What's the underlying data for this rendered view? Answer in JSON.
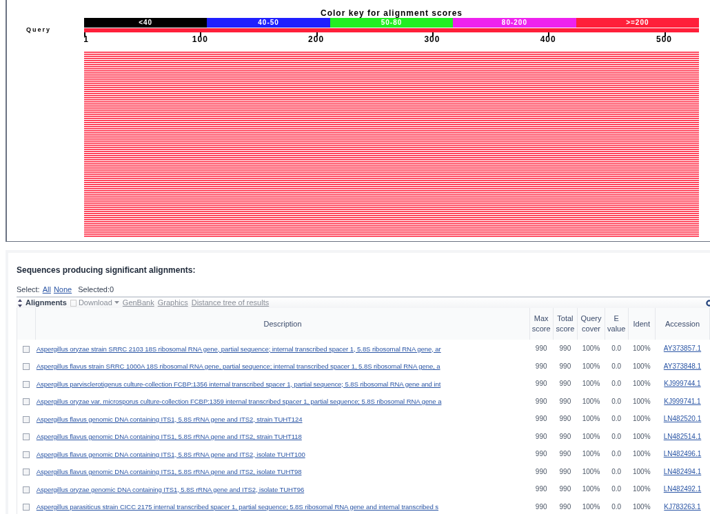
{
  "graphic": {
    "title": "Color key for alignment scores",
    "query_label": "Query",
    "color_key": [
      {
        "label": "<40",
        "color": "#000000"
      },
      {
        "label": "40-50",
        "color": "#1f1fff"
      },
      {
        "label": "50-80",
        "color": "#22ee22"
      },
      {
        "label": "80-200",
        "color": "#ee22ee"
      },
      {
        "label": ">=200",
        "color": "#ff1f3a"
      }
    ],
    "ticks": [
      "1",
      "100",
      "200",
      "300",
      "400",
      "500"
    ]
  },
  "results": {
    "heading": "Sequences producing significant alignments:",
    "select_label": "Select:",
    "select_links": [
      "All",
      "None"
    ],
    "selected_count": "Selected:0",
    "toolbar": {
      "title": "Alignments",
      "actions": [
        {
          "label": "Download",
          "kind": "menu",
          "disabled": true
        },
        {
          "label": "GenBank",
          "kind": "link",
          "disabled": true
        },
        {
          "label": "Graphics",
          "kind": "link",
          "disabled": true
        },
        {
          "label": "Distance tree of results",
          "kind": "link",
          "disabled": true
        }
      ]
    },
    "columns": [
      [
        "Description"
      ],
      [
        "Max",
        "score"
      ],
      [
        "Total",
        "score"
      ],
      [
        "Query",
        "cover"
      ],
      [
        "E",
        "value"
      ],
      [
        "Ident"
      ],
      [
        "Accession"
      ]
    ],
    "rows": [
      {
        "checked": false,
        "description": "Aspergillus oryzae strain SRRC 2103 18S ribosomal RNA gene, partial sequence; internal transcribed spacer 1, 5.8S ribosomal RNA gene, ar",
        "max_score": "990",
        "total_score": "990",
        "query_cover": "100%",
        "e_value": "0.0",
        "ident": "100%",
        "accession": "AY373857.1"
      },
      {
        "checked": false,
        "description": "Aspergillus flavus strain SRRC 1000A 18S ribosomal RNA gene, partial sequence; internal transcribed spacer 1, 5.8S ribosomal RNA gene, a",
        "max_score": "990",
        "total_score": "990",
        "query_cover": "100%",
        "e_value": "0.0",
        "ident": "100%",
        "accession": "AY373848.1"
      },
      {
        "checked": false,
        "description": "Aspergillus parvisclerotigenus culture-collection FCBP:1356 internal transcribed spacer 1, partial sequence; 5.8S ribosomal RNA gene and int",
        "max_score": "990",
        "total_score": "990",
        "query_cover": "100%",
        "e_value": "0.0",
        "ident": "100%",
        "accession": "KJ999744.1"
      },
      {
        "checked": false,
        "description": "Aspergillus oryzae var. microsporus culture-collection FCBP:1359 internal transcribed spacer 1, partial sequence; 5.8S ribosomal RNA gene a",
        "max_score": "990",
        "total_score": "990",
        "query_cover": "100%",
        "e_value": "0.0",
        "ident": "100%",
        "accession": "KJ999741.1"
      },
      {
        "checked": false,
        "description": "Aspergillus flavus genomic DNA containing ITS1, 5.8S rRNA gene and ITS2, strain TUHT124",
        "max_score": "990",
        "total_score": "990",
        "query_cover": "100%",
        "e_value": "0.0",
        "ident": "100%",
        "accession": "LN482520.1"
      },
      {
        "checked": false,
        "description": "Aspergillus flavus genomic DNA containing ITS1, 5.8S rRNA gene and ITS2, strain TUHT118",
        "max_score": "990",
        "total_score": "990",
        "query_cover": "100%",
        "e_value": "0.0",
        "ident": "100%",
        "accession": "LN482514.1"
      },
      {
        "checked": false,
        "description": "Aspergillus flavus genomic DNA containing ITS1, 5.8S rRNA gene and ITS2, isolate TUHT100",
        "max_score": "990",
        "total_score": "990",
        "query_cover": "100%",
        "e_value": "0.0",
        "ident": "100%",
        "accession": "LN482496.1"
      },
      {
        "checked": false,
        "description": "Aspergillus flavus genomic DNA containing ITS1, 5.8S rRNA gene and ITS2, isolate TUHT98",
        "max_score": "990",
        "total_score": "990",
        "query_cover": "100%",
        "e_value": "0.0",
        "ident": "100%",
        "accession": "LN482494.1"
      },
      {
        "checked": false,
        "description": "Aspergillus oryzae genomic DNA containing ITS1, 5.8S rRNA gene and ITS2, isolate TUHT96",
        "max_score": "990",
        "total_score": "990",
        "query_cover": "100%",
        "e_value": "0.0",
        "ident": "100%",
        "accession": "LN482492.1"
      },
      {
        "checked": false,
        "description": "Aspergillus parasiticus strain CICC 2175 internal transcribed spacer 1, partial sequence; 5.8S ribosomal RNA gene and internal transcribed s",
        "max_score": "990",
        "total_score": "990",
        "query_cover": "100%",
        "e_value": "0.0",
        "ident": "100%",
        "accession": "KJ783263.1"
      }
    ]
  }
}
